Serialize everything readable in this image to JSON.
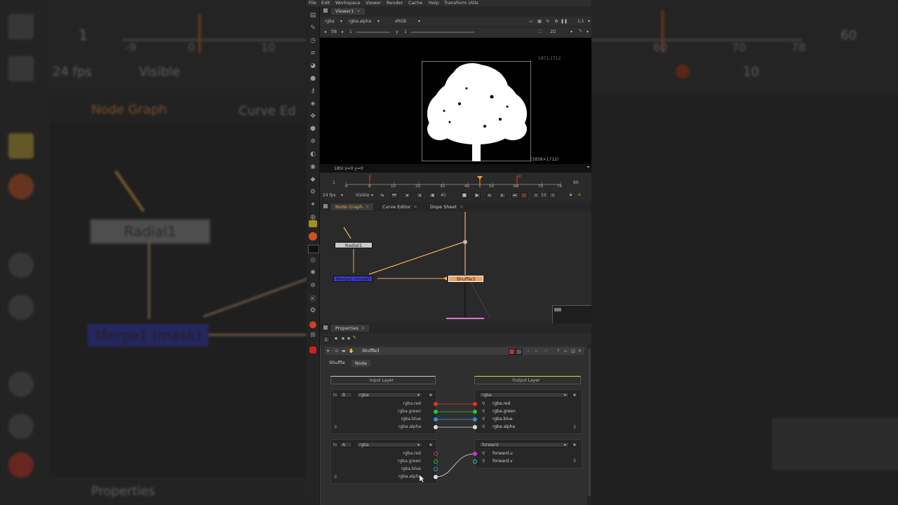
{
  "menu": [
    "File",
    "Edit",
    "Workspace",
    "Viewer",
    "Render",
    "Cache",
    "Help",
    "Transform Utils"
  ],
  "viewer": {
    "tab": "Viewer1",
    "layer": "rgba",
    "channel": "rgba.alpha",
    "lut": "sRGB",
    "fstop": "f/8",
    "fstop_val": "1",
    "gamma_label": "y",
    "gamma_val": "1",
    "zoom": "1:1",
    "mode": "2D",
    "res_top": "1971,1712",
    "res_bottom": "(1858×1712)",
    "status": "185I  x=0 y=0"
  },
  "timeline": {
    "start": "1",
    "end": "60",
    "fps": "24 fps",
    "visible": "Visible",
    "ticks": [
      "-9",
      "0",
      "10",
      "20",
      "30",
      "40",
      "50",
      "60",
      "70",
      "78"
    ],
    "marker_in": "0",
    "marker_out": "60",
    "current_frame": "45",
    "step": "10"
  },
  "nodegraph": {
    "tabs": [
      "Node Graph",
      "Curve Editor",
      "Dope Sheet"
    ],
    "nodes": {
      "radial": "Radial1",
      "merge": "Merge1 (mask)",
      "shuffle": "Shuffle3"
    }
  },
  "properties": {
    "tab": "Properties",
    "count": "1",
    "node_name": "Shuffle3",
    "subtabs": [
      "Shuffle",
      "Node"
    ],
    "input_header": "Input Layer",
    "output_header": "Output Layer",
    "in_label": "In",
    "block1": {
      "input": "B",
      "layer": "rgba",
      "out_layer": "rgba",
      "in_channels": [
        "rgba.red",
        "rgba.green",
        "rgba.blue",
        "rgba.alpha"
      ],
      "out_channels": [
        "rgba.red",
        "rgba.green",
        "rgba.blue",
        "rgba.alpha"
      ]
    },
    "block2": {
      "input": "A",
      "layer": "rgba",
      "out_layer": "forward",
      "in_channels": [
        "rgba.red",
        "rgba.green",
        "rgba.blue",
        "rgba.alpha"
      ],
      "out_channels": [
        "forward.u",
        "forward.v"
      ]
    }
  },
  "background": {
    "left": {
      "frame": "1",
      "fps": "24 fps",
      "visible": "Visible",
      "tabs": [
        "Node Graph",
        "Curve Ed"
      ],
      "ticks": [
        "-9",
        "0",
        "10"
      ],
      "radial": "Radial1",
      "merge": "Merge1 (mask)",
      "properties": "Properties"
    },
    "right": {
      "ticks": [
        "60",
        "70",
        "78"
      ],
      "end": "60",
      "step": "10"
    }
  },
  "colors": {
    "accent": "#f0a030",
    "merge_node": "#3a3ac8",
    "shuffle_node": "#f0a060",
    "red": "#e03030",
    "green": "#30c030",
    "blue": "#3090d0"
  }
}
